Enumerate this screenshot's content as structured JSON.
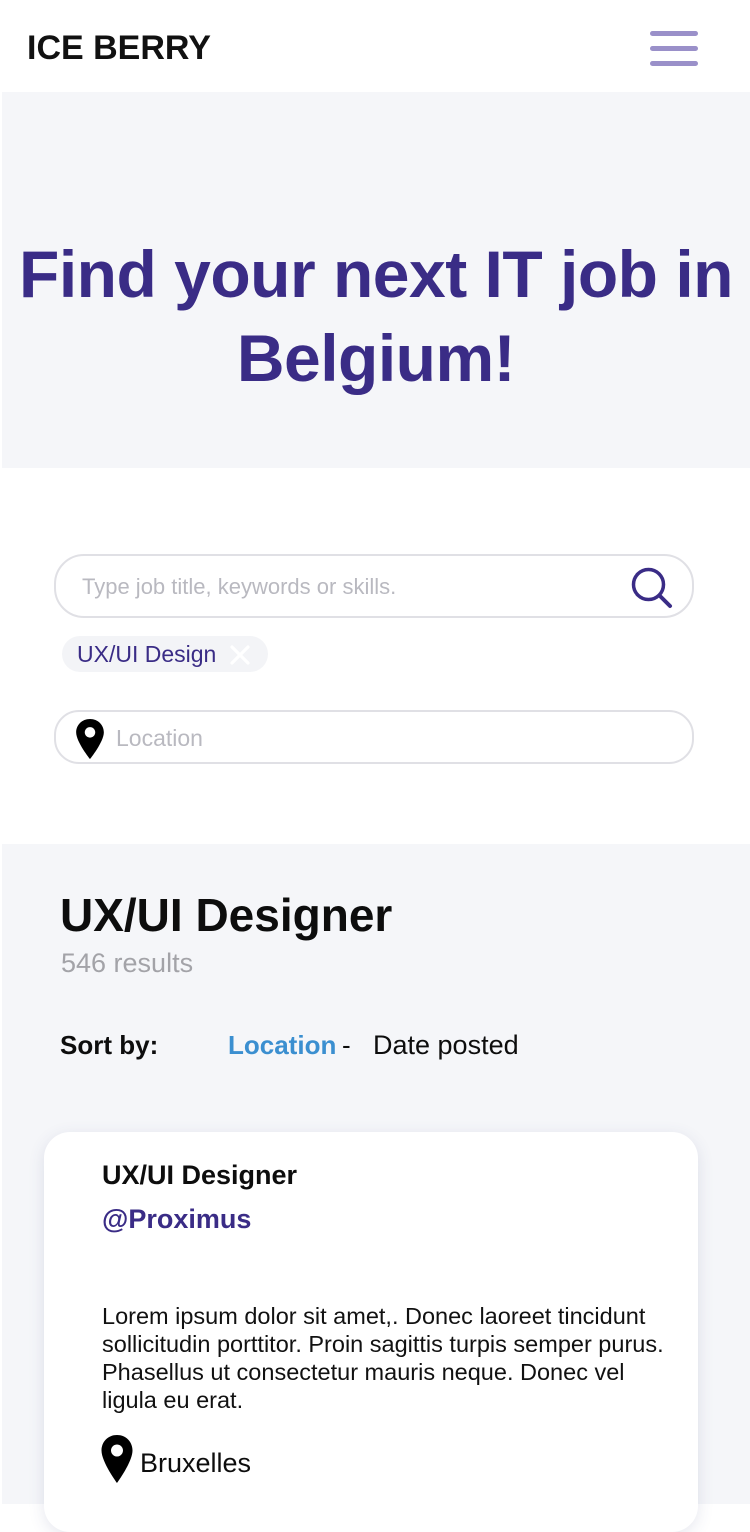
{
  "header": {
    "brand": "ICE BERRY",
    "menu_icon": "hamburger-menu-icon"
  },
  "hero": {
    "title": "Find your next IT job in Belgium!"
  },
  "search": {
    "placeholder": "Type job title, keywords or skills.",
    "value": "",
    "search_icon": "search-icon",
    "tags": [
      {
        "label": "UX/UI Design",
        "remove_icon": "close-icon"
      }
    ]
  },
  "location": {
    "placeholder": "Location",
    "value": "",
    "icon": "map-pin-icon"
  },
  "results": {
    "title": "UX/UI Designer",
    "count": "546 results",
    "sort": {
      "label": "Sort by:",
      "options": [
        "Location",
        "Date posted"
      ],
      "separator": "-",
      "active": "Location"
    }
  },
  "jobs": [
    {
      "title": "UX/UI Designer",
      "company": "@Proximus",
      "description": "Lorem ipsum dolor sit amet,. Donec laoreet tincidunt sollicitudin porttitor. Proin sagittis turpis semper purus. Phasellus ut consectetur mauris neque. Donec vel ligula eu erat.",
      "location": "Bruxelles",
      "location_icon": "map-pin-icon"
    }
  ],
  "colors": {
    "brand_purple": "#3a2c86",
    "menu_lavender": "#9a90c9",
    "sort_active_blue": "#3b8fd0",
    "section_gray": "#f5f6f9",
    "muted_text": "#a3a3a8"
  }
}
